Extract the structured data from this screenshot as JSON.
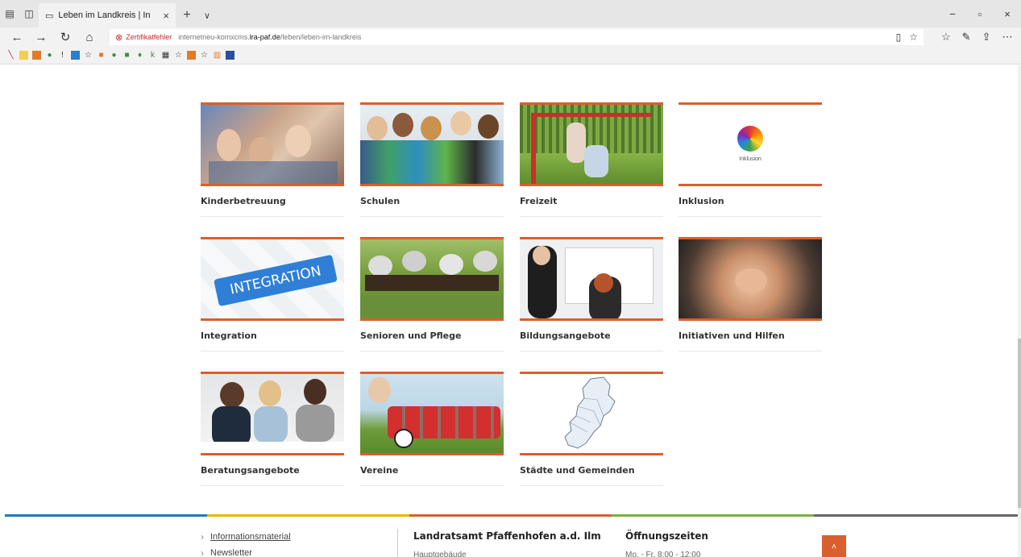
{
  "browser": {
    "tab_title": "Leben im Landkreis | In",
    "tab_close": "×",
    "new_tab": "+",
    "tabs_menu": "∨",
    "window_controls": [
      "−",
      "▫",
      "×"
    ],
    "cert_warning": "Zertifikatfehler",
    "url_pre": "internetneu-komxcms.",
    "url_host": "lra-paf.de",
    "url_path": "/leben/leben-im-landkreis"
  },
  "tiles": [
    {
      "label": "Kinderbetreuung"
    },
    {
      "label": "Schulen"
    },
    {
      "label": "Freizeit"
    },
    {
      "label": "Inklusion",
      "image_text": "Inklusion"
    },
    {
      "label": "Integration",
      "image_text": "INTEGRATION"
    },
    {
      "label": "Senioren und Pflege"
    },
    {
      "label": "Bildungsangebote"
    },
    {
      "label": "Initiativen und Hilfen"
    },
    {
      "label": "Beratungsangebote"
    },
    {
      "label": "Vereine"
    },
    {
      "label": "Städte und Gemeinden"
    }
  ],
  "footer": {
    "links": [
      "Informationsmaterial",
      "Newsletter"
    ],
    "org_title": "Landratsamt Pfaffenhofen a.d. Ilm",
    "org_sub": "Hauptgebäude",
    "hours_title": "Öffnungszeiten",
    "hours_sub": "Mo. - Fr.   8:00 - 12:00"
  },
  "colors": {
    "accent": "#d95f2f",
    "footer_lines": [
      "#1a7bbf",
      "#f0b400",
      "#d95f2f",
      "#7bb33a",
      "#666666"
    ]
  }
}
